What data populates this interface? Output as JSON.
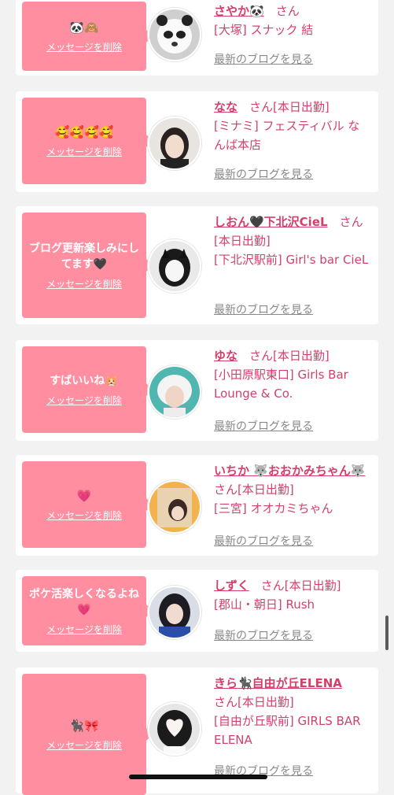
{
  "delete_label": "メッセージを削除",
  "blog_label": "最新のブログを見る",
  "san_label": "さん",
  "cards": [
    {
      "message": "🐼🙈",
      "name": "さやか🐼",
      "status": "",
      "shop": "[大塚] スナック 結"
    },
    {
      "message": "🥰🥰🥰🥰",
      "name": "なな",
      "status": "[本日出勤]",
      "shop": "[ミナミ] フェスティバル なんば本店"
    },
    {
      "message": "ブログ更新楽しみにしてます🖤",
      "name": "しおん🖤下北沢CieL",
      "status": "[本日出勤]",
      "shop": "[下北沢駅前] Girl's bar CieL"
    },
    {
      "message": "すばいいね🐹",
      "name": "ゆな",
      "status": "[本日出勤]",
      "shop": "[小田原駅東口] Girls Bar Lounge & Co."
    },
    {
      "message": "💗",
      "name": "いちか 🐺おおかみちゃん🐺",
      "status": "[本日出勤]",
      "shop": "[三宮] オオカミちゃん"
    },
    {
      "message": "ポケ活楽しくなるよね💗",
      "name": "しずく",
      "status": "[本日出勤]",
      "shop": "[郡山・朝日] Rush"
    },
    {
      "message": "🐈‍⬛🎀",
      "name": "きら🐈‍⬛自由が丘ELENA",
      "status": "[本日出勤]",
      "shop": "[自由が丘駅前] GIRLS BAR ELENA"
    }
  ]
}
